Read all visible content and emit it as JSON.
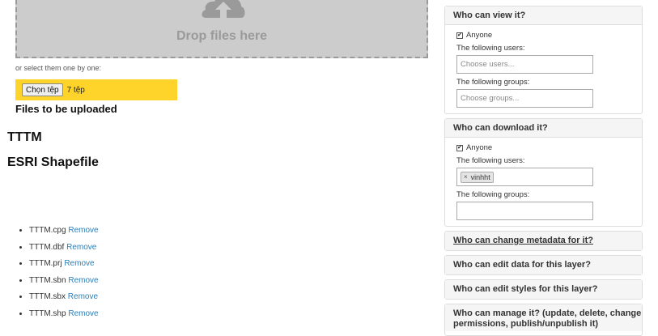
{
  "upload": {
    "drop_text": "Drop files here",
    "select_hint": "or select them one by one:",
    "choose_button": "Chọn tệp",
    "file_count": "7 tệp",
    "files_heading": "Files to be uploaded"
  },
  "layer": {
    "name": "TTTM",
    "type": "ESRI Shapefile",
    "remove_label": "Remove",
    "files": [
      "TTTM.cpg",
      "TTTM.dbf",
      "TTTM.prj",
      "TTTM.sbn",
      "TTTM.sbx",
      "TTTM.shp"
    ]
  },
  "permissions": {
    "view": {
      "title": "Who can view it?",
      "anyone_label": "Anyone",
      "anyone_checked": true,
      "users_label": "The following users:",
      "users_placeholder": "Choose users...",
      "groups_label": "The following groups:",
      "groups_placeholder": "Choose groups..."
    },
    "download": {
      "title": "Who can download it?",
      "anyone_label": "Anyone",
      "anyone_checked": true,
      "users_label": "The following users:",
      "selected_user": "vinhht",
      "tag_remove": "×",
      "groups_label": "The following groups:"
    },
    "change_metadata": "Who can change metadata for it?",
    "edit_data": "Who can edit data for this layer?",
    "edit_styles": "Who can edit styles for this layer?",
    "manage": "Who can manage it? (update, delete, change permissions, publish/unpublish it)"
  },
  "colors": {
    "file_bar": "#ffd42a",
    "dropzone": "#cccccc",
    "link": "#2a7fb8"
  },
  "icons": {
    "upload": "cloud-upload-icon",
    "checkbox": "checkmark"
  }
}
